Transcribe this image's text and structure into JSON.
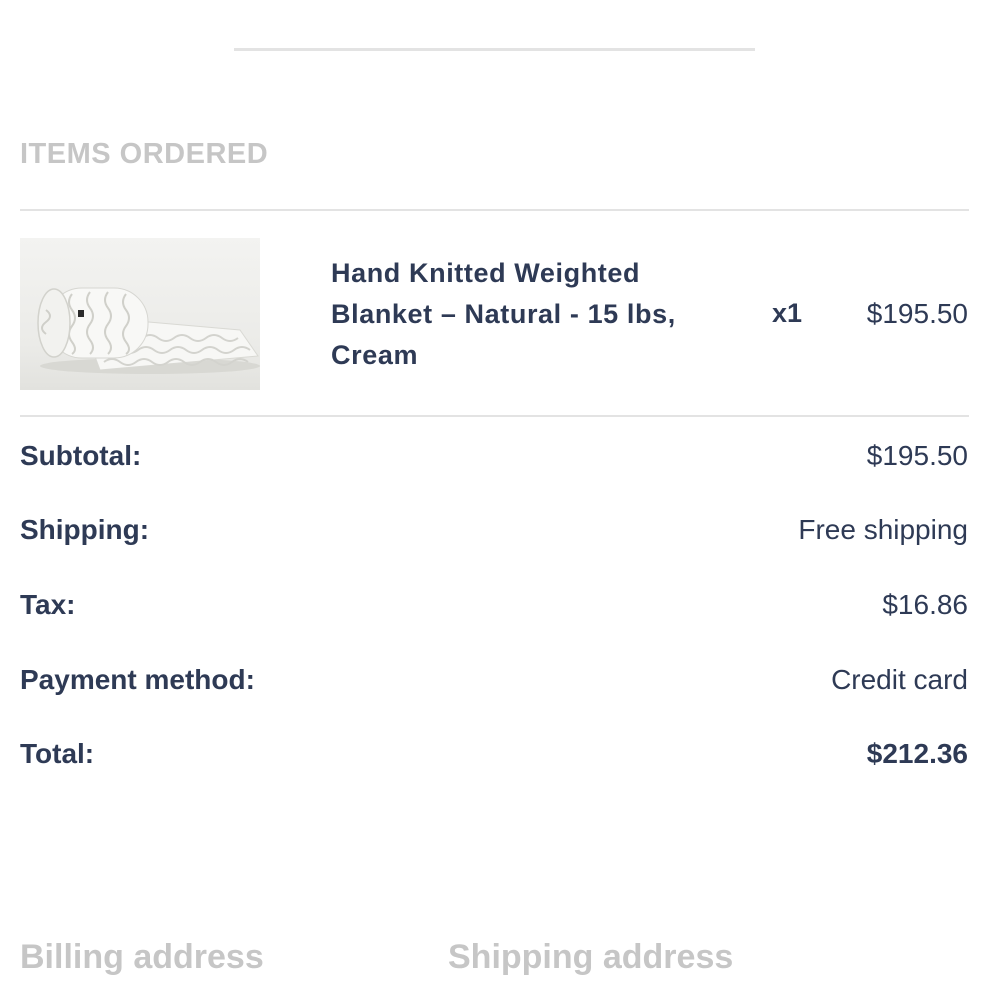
{
  "items_section": {
    "heading": "ITEMS ORDERED"
  },
  "items": [
    {
      "name": "Hand Knitted Weighted Blanket – Natural - 15 lbs, Cream",
      "quantity": "x1",
      "price": "$195.50",
      "thumbnail": "rolled-knit-blanket-image"
    }
  ],
  "summary": {
    "subtotal_label": "Subtotal:",
    "subtotal_value": "$195.50",
    "shipping_label": "Shipping:",
    "shipping_value": "Free shipping",
    "tax_label": "Tax:",
    "tax_value": "$16.86",
    "payment_label": "Payment method:",
    "payment_value": "Credit card",
    "total_label": "Total:",
    "total_value": "$212.36"
  },
  "addresses": {
    "billing_heading": "Billing address",
    "shipping_heading": "Shipping address"
  },
  "colors": {
    "text_primary": "#2e3a55",
    "heading_muted": "#c6c6c6",
    "divider": "#e3e3e3"
  }
}
